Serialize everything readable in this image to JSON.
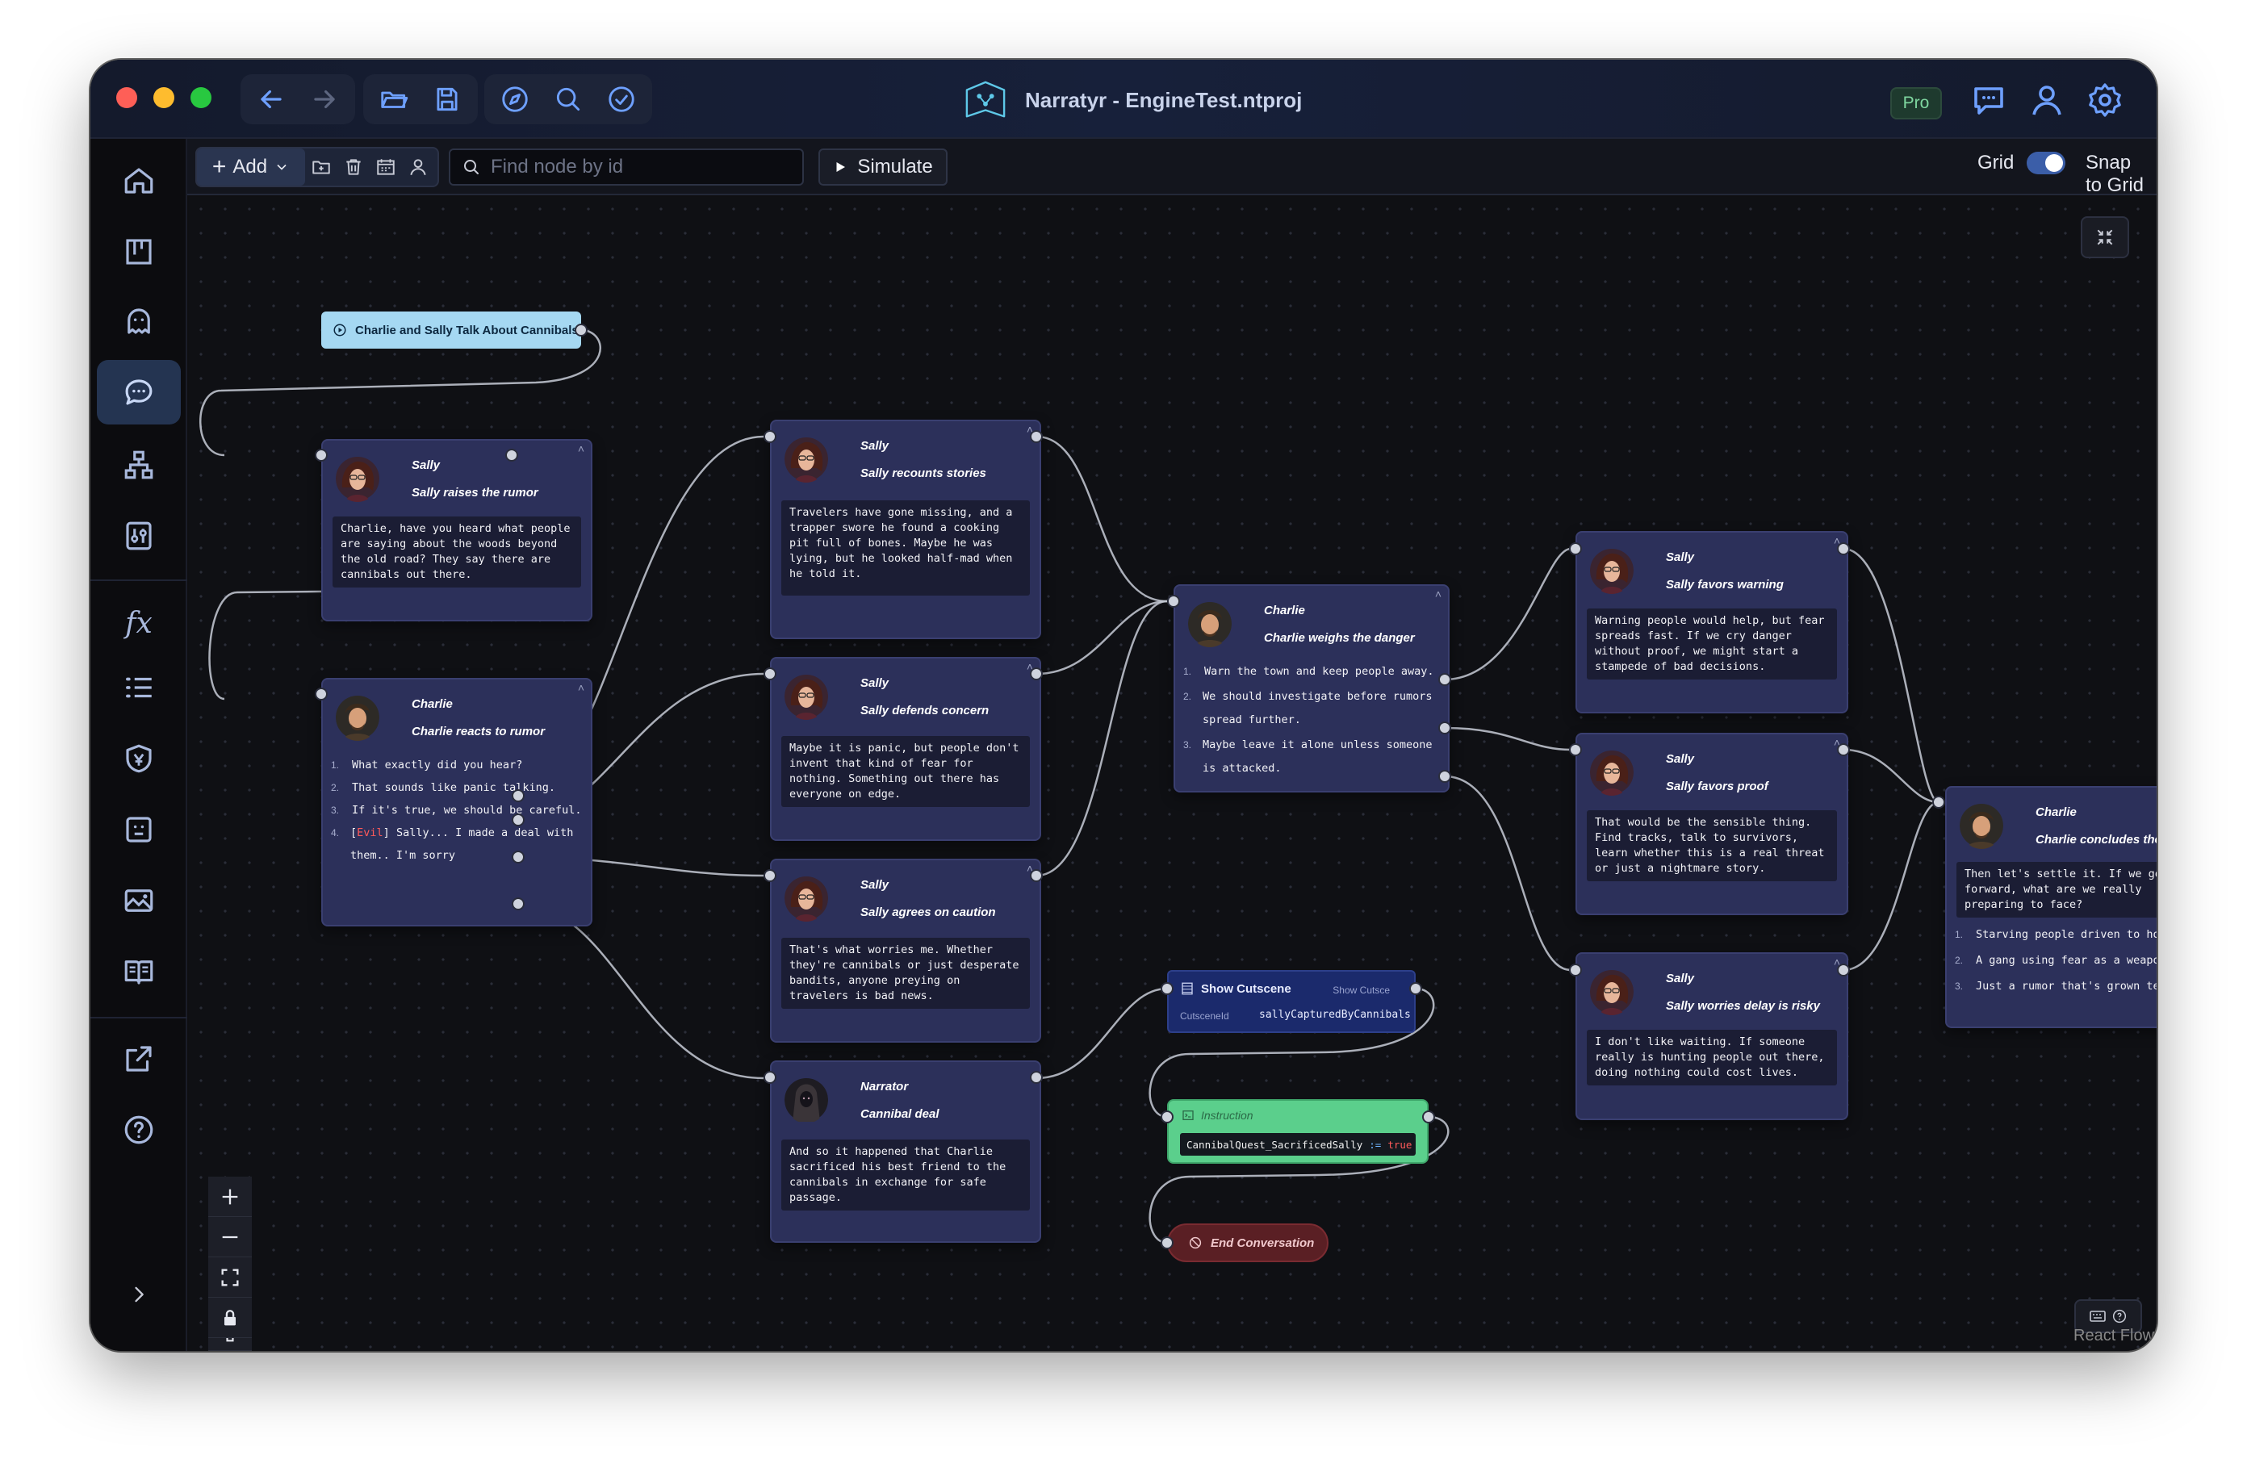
{
  "app": {
    "title": "Narratyr - EngineTest.ntproj",
    "badge": "Pro"
  },
  "toolbar": {
    "add_label": "Add",
    "search_placeholder": "Find node by id",
    "simulate_label": "Simulate",
    "grid_label": "Grid",
    "snap_label": "Snap to Grid",
    "grid_on": true,
    "snap_on": true
  },
  "sidebar": {
    "items": [
      "home-icon",
      "board-icon",
      "ghost-icon",
      "chat-icon",
      "hierarchy-icon",
      "sliders-icon",
      "function-icon",
      "list-icon",
      "shield-icon",
      "face-icon",
      "image-icon",
      "book-icon",
      "export-icon",
      "help-icon",
      "expand-icon"
    ],
    "fx_label": "fx",
    "active": "chat-icon"
  },
  "start": {
    "label": "Charlie and Sally Talk About Cannibals"
  },
  "nodes": {
    "n1": {
      "speaker": "Sally",
      "title": "Sally raises the rumor",
      "text": "Charlie, have you heard what people are saying about the woods beyond the old road? They say there are cannibals out there."
    },
    "n2": {
      "speaker": "Charlie",
      "title": "Charlie reacts to rumor",
      "choices": [
        {
          "num": "1.",
          "text": "What exactly did you hear?"
        },
        {
          "num": "2.",
          "text": "That sounds like panic talking."
        },
        {
          "num": "3.",
          "text": "If it's true, we should be careful."
        },
        {
          "num": "4.",
          "tag": "Evil",
          "text": "Sally... I made a deal with them.. I'm sorry"
        }
      ]
    },
    "n3": {
      "speaker": "Sally",
      "title": "Sally recounts stories",
      "text": "Travelers have gone missing, and a trapper swore he found a cooking pit full of bones. Maybe he was lying, but he looked half-mad when he told it."
    },
    "n4": {
      "speaker": "Sally",
      "title": "Sally defends concern",
      "text": "Maybe it is panic, but people don't invent that kind of fear for nothing. Something out there has everyone on edge."
    },
    "n5": {
      "speaker": "Sally",
      "title": "Sally agrees on caution",
      "text": "That's what worries me. Whether they're cannibals or just desperate bandits, anyone preying on travelers is bad news."
    },
    "n6": {
      "speaker": "Narrator",
      "title": "Cannibal deal",
      "text": "And so it happened that Charlie sacrificed his best friend to the cannibals in exchange for safe passage."
    },
    "n7": {
      "speaker": "Charlie",
      "title": "Charlie weighs the danger",
      "choices": [
        {
          "num": "1.",
          "text": "Warn the town and keep people away."
        },
        {
          "num": "2.",
          "text": "We should investigate before rumors spread further."
        },
        {
          "num": "3.",
          "text": "Maybe leave it alone unless someone is attacked."
        }
      ]
    },
    "n8": {
      "speaker": "Sally",
      "title": "Sally favors warning",
      "text": "Warning people would help, but fear spreads fast. If we cry danger without proof, we might start a stampede of bad decisions."
    },
    "n9": {
      "speaker": "Sally",
      "title": "Sally favors proof",
      "text": "That would be the sensible thing. Find tracks, talk to survivors, learn whether this is a real threat or just a nightmare story."
    },
    "n10": {
      "speaker": "Sally",
      "title": "Sally worries delay is risky",
      "text": "I don't like waiting. If someone really is hunting people out there, doing nothing could cost lives."
    },
    "n11": {
      "speaker": "Charlie",
      "title": "Charlie concludes the talk",
      "text": "Then let's settle it. If we go forward, what are we really preparing to face?",
      "choices": [
        {
          "num": "1.",
          "text": "Starving people driven to horror."
        },
        {
          "num": "2.",
          "text": "A gang using fear as a weapon."
        },
        {
          "num": "3.",
          "text": "Just a rumor that's grown teeth."
        }
      ]
    }
  },
  "cutscene": {
    "title": "Show Cutscene",
    "subtitle": "Show Cutsce",
    "key": "CutsceneId",
    "value": "sallyCapturedByCannibals"
  },
  "instruction": {
    "title": "Instruction",
    "var": "CannibalQuest_SacrificedSally",
    "op": ":=",
    "value": "true"
  },
  "end": {
    "label": "End Conversation"
  },
  "attribution": "React Flow",
  "colors": {
    "node_bg": "#2c305a",
    "start_bg": "#a5d8f2",
    "instruction_bg": "#5bcf8c",
    "end_bg": "#5a1f24",
    "cutscene_bg": "#1b2a6c",
    "evil": "#ff5a5a"
  }
}
